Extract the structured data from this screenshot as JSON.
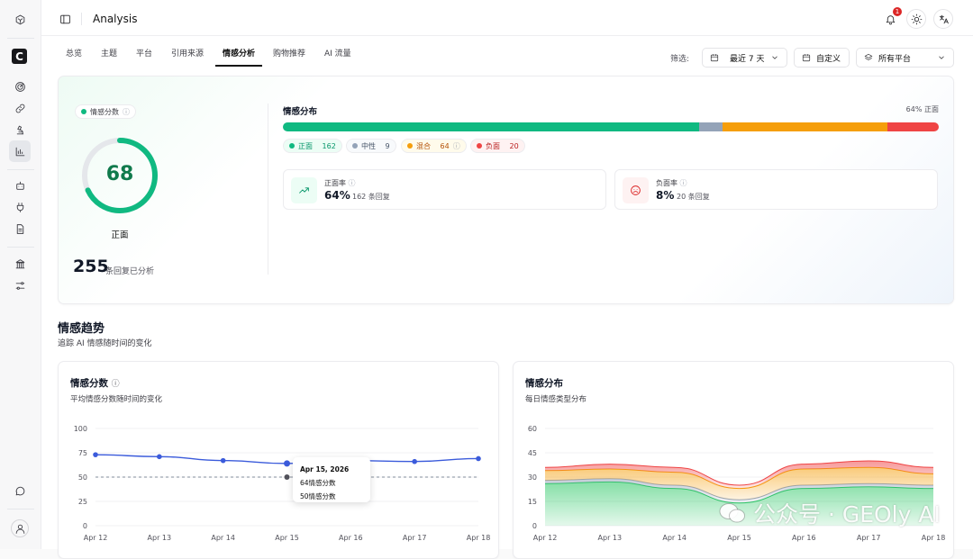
{
  "header": {
    "title": "Analysis",
    "notification_count": "1"
  },
  "tabs": [
    "总览",
    "主题",
    "平台",
    "引用来源",
    "情感分析",
    "购物推荐",
    "AI 流量"
  ],
  "filters": {
    "label": "筛选:",
    "range": "最近 7 天",
    "custom": "自定义",
    "platform": "所有平台"
  },
  "sentiment": {
    "pill": "情感分数",
    "score": "68",
    "score_value": 68,
    "label": "正面",
    "count": "255",
    "count_sub": "条回复已分析"
  },
  "distribution": {
    "title": "情感分布",
    "right": "64% 正面",
    "segments": [
      {
        "name": "正面",
        "count": "162",
        "value": 162,
        "color": "#10b981"
      },
      {
        "name": "中性",
        "count": "9",
        "value": 9,
        "color": "#94a3b8"
      },
      {
        "name": "混合",
        "count": "64",
        "value": 64,
        "color": "#f59e0b"
      },
      {
        "name": "负面",
        "count": "20",
        "value": 20,
        "color": "#ef4444"
      }
    ],
    "positive": {
      "label": "正面率",
      "value": "64%",
      "sub": "162 条回复"
    },
    "negative": {
      "label": "负面率",
      "value": "8%",
      "sub": "20 条回复"
    }
  },
  "section": {
    "title": "情感趋势",
    "subtitle": "追踪 AI 情感随时间的变化"
  },
  "chart1": {
    "title": "情感分数",
    "subtitle": "平均情感分数随时间的变化",
    "tooltip": {
      "date": "Apr 15, 2026",
      "line1": "64情感分数",
      "line2": "50情感分数"
    }
  },
  "chart2": {
    "title": "情感分布",
    "subtitle": "每日情感类型分布"
  },
  "chart_data": [
    {
      "type": "line",
      "title": "情感分数",
      "x": [
        "Apr 12",
        "Apr 13",
        "Apr 14",
        "Apr 15",
        "Apr 16",
        "Apr 17",
        "Apr 18"
      ],
      "series": [
        {
          "values": [
            73,
            71,
            67,
            64,
            67,
            66,
            69
          ],
          "color": "#3b5bdb"
        },
        {
          "values": [
            50,
            50,
            50,
            50,
            50,
            50,
            50
          ],
          "color": "#9ca3af"
        }
      ],
      "ylim": [
        0,
        100
      ],
      "yticks": [
        0,
        25,
        50,
        75,
        100
      ]
    },
    {
      "type": "area",
      "title": "情感分布",
      "x": [
        "Apr 12",
        "Apr 13",
        "Apr 14",
        "Apr 15",
        "Apr 16",
        "Apr 17",
        "Apr 18"
      ],
      "series": [
        {
          "values": [
            26,
            27,
            23,
            14,
            23,
            24,
            23
          ],
          "color": "#22c55e"
        },
        {
          "values": [
            2,
            2,
            2,
            2,
            2,
            2,
            2
          ],
          "color": "#94a3b8"
        },
        {
          "values": [
            6,
            6,
            8,
            7,
            10,
            10,
            7
          ],
          "color": "#f59e0b"
        },
        {
          "values": [
            2,
            3,
            3,
            2,
            3,
            4,
            4
          ],
          "color": "#ef4444"
        }
      ],
      "ylim": [
        0,
        60
      ],
      "yticks": [
        0,
        15,
        30,
        45,
        60
      ]
    }
  ],
  "watermark": "公众号 · GEOly AI"
}
